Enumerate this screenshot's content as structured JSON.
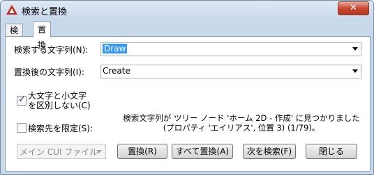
{
  "window": {
    "title": "検索と置換",
    "close_glyph": "✕"
  },
  "tabs": [
    {
      "label": "検索"
    },
    {
      "label": "置換"
    }
  ],
  "find": {
    "label": "検索する文字列(N):",
    "value": "Draw"
  },
  "replace": {
    "label": "置換後の文字列(I):",
    "value": "Create"
  },
  "match_case": {
    "label_line1": "大文字と小文字",
    "label_line2": "を区別しない(C)",
    "checked": true
  },
  "restrict": {
    "label": "検索先を限定(S):",
    "checked": false
  },
  "scope": {
    "value": "メイン CUI ファイル"
  },
  "message": "検索文字列が ツリー ノード 'ホーム 2D - 作成' に見つかりました(プロパティ 'エイリアス', 位置 3) (1/79)。",
  "buttons": {
    "replace": "置換(R)",
    "replace_all": "すべて置換(A)",
    "find_next": "次を検索(F)",
    "close": "閉じる"
  }
}
